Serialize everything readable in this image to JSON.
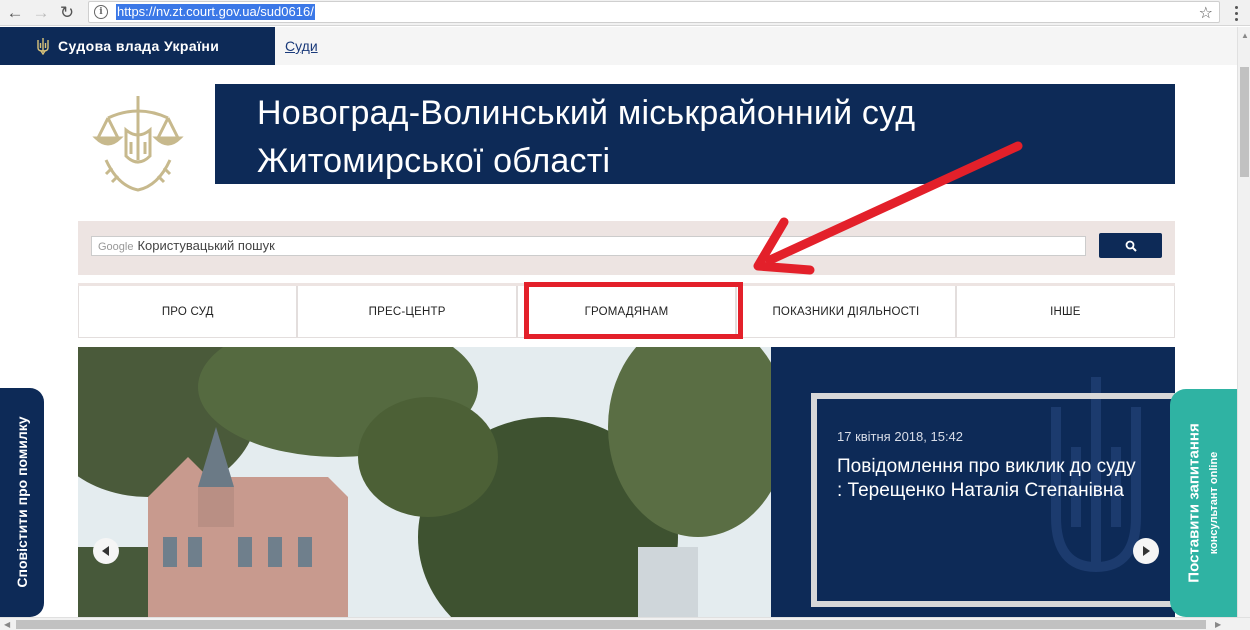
{
  "browser": {
    "url": "https://nv.zt.court.gov.ua/sud0616/",
    "back_icon": "←",
    "forward_icon": "→",
    "reload_icon": "↻",
    "star_icon": "☆"
  },
  "topbar": {
    "brand": "Судова влада України",
    "courts_link": "Суди"
  },
  "header": {
    "title_line1": "Новоград-Волинський міськрайонний суд",
    "title_line2": "Житомирської області"
  },
  "search": {
    "google_label": "Google",
    "placeholder": "Користувацький пошук"
  },
  "nav": {
    "items": [
      "ПРО СУД",
      "ПРЕС-ЦЕНТР",
      "ГРОМАДЯНАМ",
      "ПОКАЗНИКИ ДІЯЛЬНОСТІ",
      "ІНШЕ"
    ]
  },
  "slider": {
    "date": "17 квітня 2018, 15:42",
    "title": "Повідомлення про виклик до суду : Терещенко Наталія Степанівна"
  },
  "side_tabs": {
    "left": "Сповістити про помилку",
    "right_line1": "Поставити запитання",
    "right_line2": "консультант online"
  },
  "colors": {
    "navy": "#0d2a57",
    "highlight_red": "#e3202a",
    "teal": "#2fb3a3",
    "search_band": "#ede4e2"
  }
}
